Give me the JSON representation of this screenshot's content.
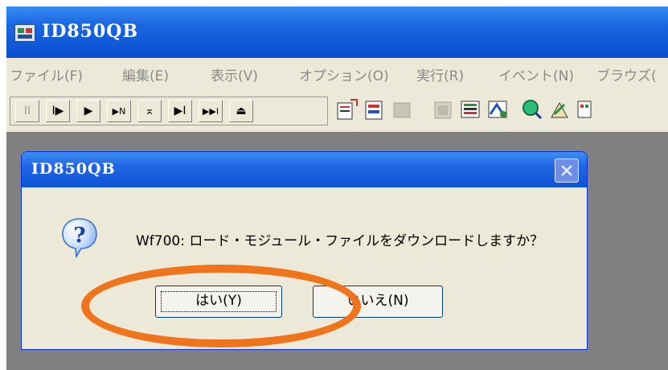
{
  "app": {
    "title": "ID850QB"
  },
  "menu": [
    "ファイル(F)",
    "編集(E)",
    "表示(V)",
    "オプション(O)",
    "実行(R)",
    "イベント(N)",
    "ブラウズ("
  ],
  "toolbar": {
    "transport_buttons": [
      {
        "glyph": "II",
        "icon": "pause-icon"
      },
      {
        "glyph": "I▶",
        "icon": "step-icon"
      },
      {
        "glyph": "▶",
        "icon": "run-icon"
      },
      {
        "glyph": "▶N",
        "icon": "run-to-n-icon"
      },
      {
        "glyph": "⌅",
        "icon": "reset-icon"
      },
      {
        "glyph": "▶I",
        "icon": "step-over-icon"
      },
      {
        "glyph": "▶▶I",
        "icon": "return-icon"
      },
      {
        "glyph": "⏏",
        "icon": "eject-icon"
      }
    ]
  },
  "dialog": {
    "title": "ID850QB",
    "message": "Wf700: ロード・モジュール・ファイルをダウンロードしますか？",
    "yes_label": "はい(Y)",
    "no_label": "いいえ(N)",
    "icon": "question-icon"
  },
  "colors": {
    "highlight": "#f0741c",
    "titlebar": "#0a4fd0"
  }
}
